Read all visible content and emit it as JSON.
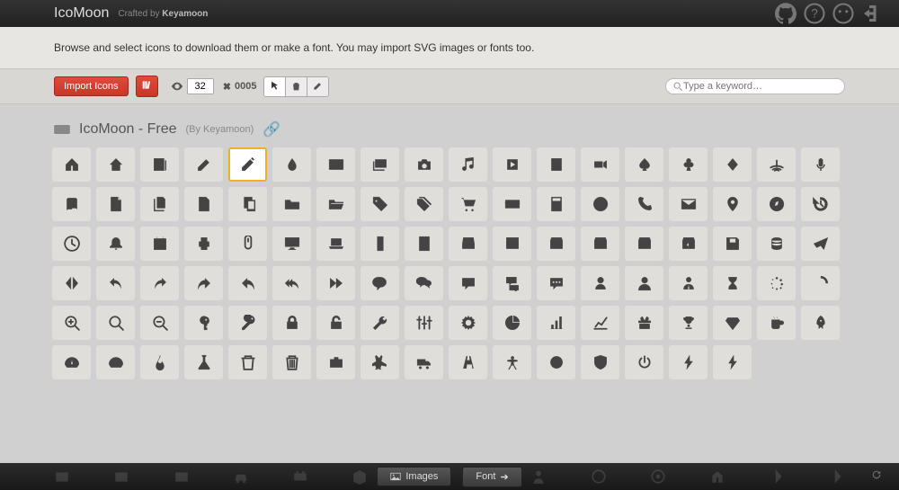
{
  "header": {
    "brand": "IcoMoon",
    "crafted": "Crafted by",
    "author": "Keyamoon"
  },
  "intro": "Browse and select icons to download them or make a font. You may import SVG images or fonts too.",
  "toolbar": {
    "import_label": "Import Icons",
    "visible_count": "32",
    "hidden_count": "0005",
    "search_placeholder": "Type a keyword…"
  },
  "set": {
    "title": "IcoMoon - Free",
    "by_prefix": "(By ",
    "author": "Keyamoon",
    "by_suffix": ")"
  },
  "icons": [
    "home",
    "home2",
    "newspaper",
    "pencil",
    "pencil2",
    "droplet",
    "image",
    "images",
    "camera",
    "music",
    "play",
    "film",
    "video-camera",
    "spade",
    "club",
    "diamond",
    "connection",
    "mic",
    "book",
    "file-empty",
    "files-empty",
    "file-text",
    "copy",
    "folder",
    "folder-open",
    "tag",
    "tags",
    "cart",
    "credit-card",
    "calculator",
    "lifebuoy",
    "phone",
    "envelope",
    "location",
    "compass",
    "history",
    "clock",
    "bell",
    "calendar",
    "printer",
    "mouse",
    "display",
    "laptop",
    "mobile",
    "tablet",
    "drawer",
    "drawer2",
    "box-add",
    "box-remove",
    "download",
    "upload",
    "floppy-disk",
    "database",
    "paper-plane",
    "flip-horizontal",
    "undo",
    "redo",
    "forward",
    "reply",
    "reply-all",
    "fast-forward",
    "bubble",
    "bubbles",
    "comment",
    "comments",
    "dots",
    "user",
    "user2",
    "user-tie",
    "hourglass",
    "spinner",
    "spinner2",
    "zoom-in",
    "search",
    "zoom-out",
    "key",
    "key2",
    "lock",
    "unlocked",
    "wrench",
    "equalizer",
    "cog",
    "pie-chart",
    "bar-chart",
    "stats",
    "gift",
    "trophy",
    "diamond2",
    "mug",
    "rocket",
    "meter",
    "meter2",
    "fire",
    "lab",
    "bin",
    "bin2",
    "briefcase",
    "airplane",
    "truck",
    "road",
    "accessibility",
    "target",
    "shield",
    "power",
    "flash",
    "flash2"
  ],
  "selected_index": 4,
  "footer": {
    "images_label": "Images",
    "font_label": "Font"
  }
}
